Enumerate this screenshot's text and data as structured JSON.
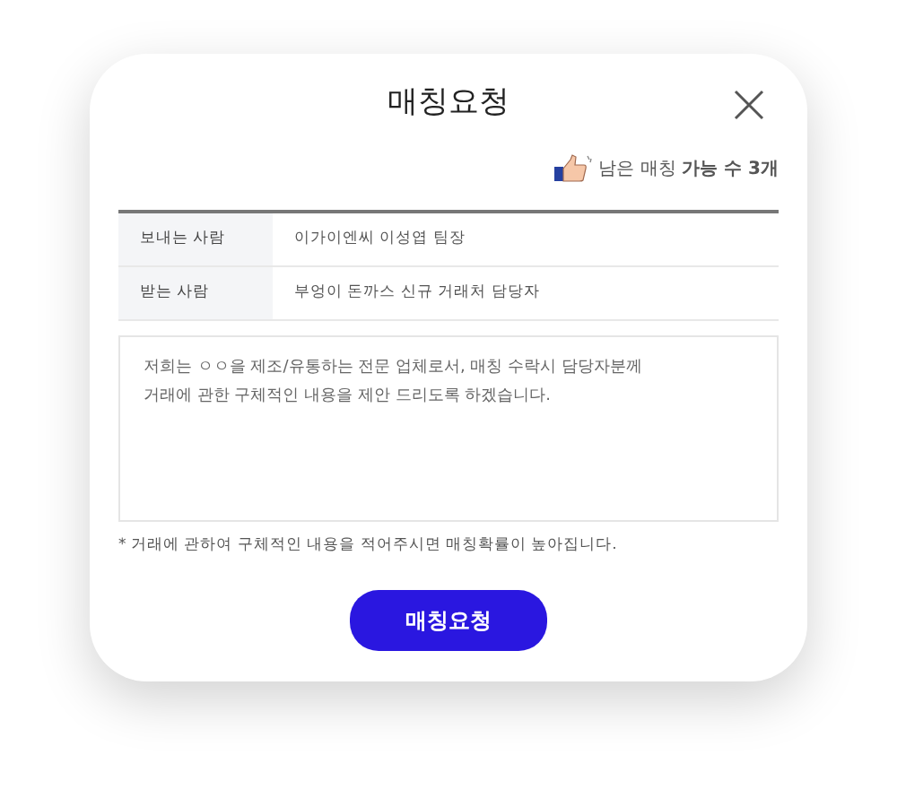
{
  "dialog": {
    "title": "매칭요청"
  },
  "remaining": "남은 매칭 **가능 수 3개**",
  "fields": [
    {
      "label": "보내는 사람",
      "value": "이가이엔씨 이성엽 팀장"
    },
    {
      "label": "받는 사람",
      "value": "부엉이 돈까스 신규 거래처 담당자"
    }
  ],
  "message": {
    "placeholder": "저희는 ㅇㅇ을 제조/유통하는 전문 업체로서, 매칭 수락시 담당자분께\n거래에 관한 구체적인 내용을 제안 드리도록 하겠습니다."
  },
  "note": "* 거래에 관하여 구체적인 내용을 적어주시면 매칭확률이 높아집니다.",
  "submit": "매칭요청"
}
